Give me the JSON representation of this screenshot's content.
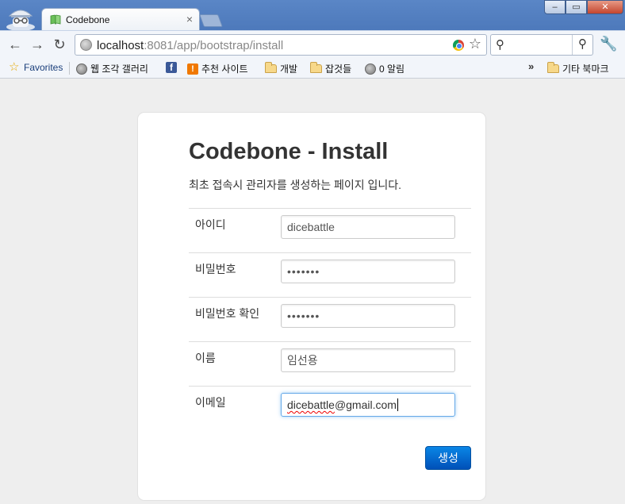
{
  "browser": {
    "tab": {
      "title": "Codebone",
      "close_glyph": "×"
    },
    "nav": {
      "back_glyph": "←",
      "forward_glyph": "→",
      "reload_glyph": "↻"
    },
    "omnibox": {
      "url_host": "localhost",
      "url_rest": ":8081/app/bootstrap/install"
    },
    "window_controls": {
      "minimize": "–",
      "maximize": "▭",
      "close": "✕"
    },
    "bookmarks": {
      "items": [
        {
          "label": "Favorites",
          "icon": "star-icon"
        },
        {
          "label": "웹 조각 갤러리",
          "icon": "globe-icon"
        },
        {
          "label": "",
          "icon": "facebook-icon"
        },
        {
          "label": "추천 사이트",
          "icon": "suggested-sites-icon"
        },
        {
          "label": "개발",
          "icon": "folder-icon"
        },
        {
          "label": "잡것들",
          "icon": "folder-icon"
        },
        {
          "label": "0 알림",
          "icon": "globe-icon"
        }
      ],
      "overflow_glyph": "»",
      "other_bookmarks": {
        "label": "기타 북마크",
        "icon": "folder-icon"
      }
    }
  },
  "page": {
    "title": "Codebone - Install",
    "description": "최초 접속시 관리자를 생성하는 페이지 입니다.",
    "fields": [
      {
        "label": "아이디",
        "value": "dicebattle",
        "type": "text"
      },
      {
        "label": "비밀번호",
        "value": "•••••••",
        "type": "password"
      },
      {
        "label": "비밀번호 확인",
        "value": "•••••••",
        "type": "password"
      },
      {
        "label": "이름",
        "value": "임선용",
        "type": "text"
      },
      {
        "label": "이메일",
        "value_spelled": "dicebattle",
        "value_rest": "@gmail.com",
        "type": "email",
        "focused": true
      }
    ],
    "submit_label": "생성"
  },
  "colors": {
    "accent": "#0066cc",
    "page_bg": "#eeeeee",
    "card_bg": "#ffffff",
    "titlebar": "#5a86c6"
  }
}
